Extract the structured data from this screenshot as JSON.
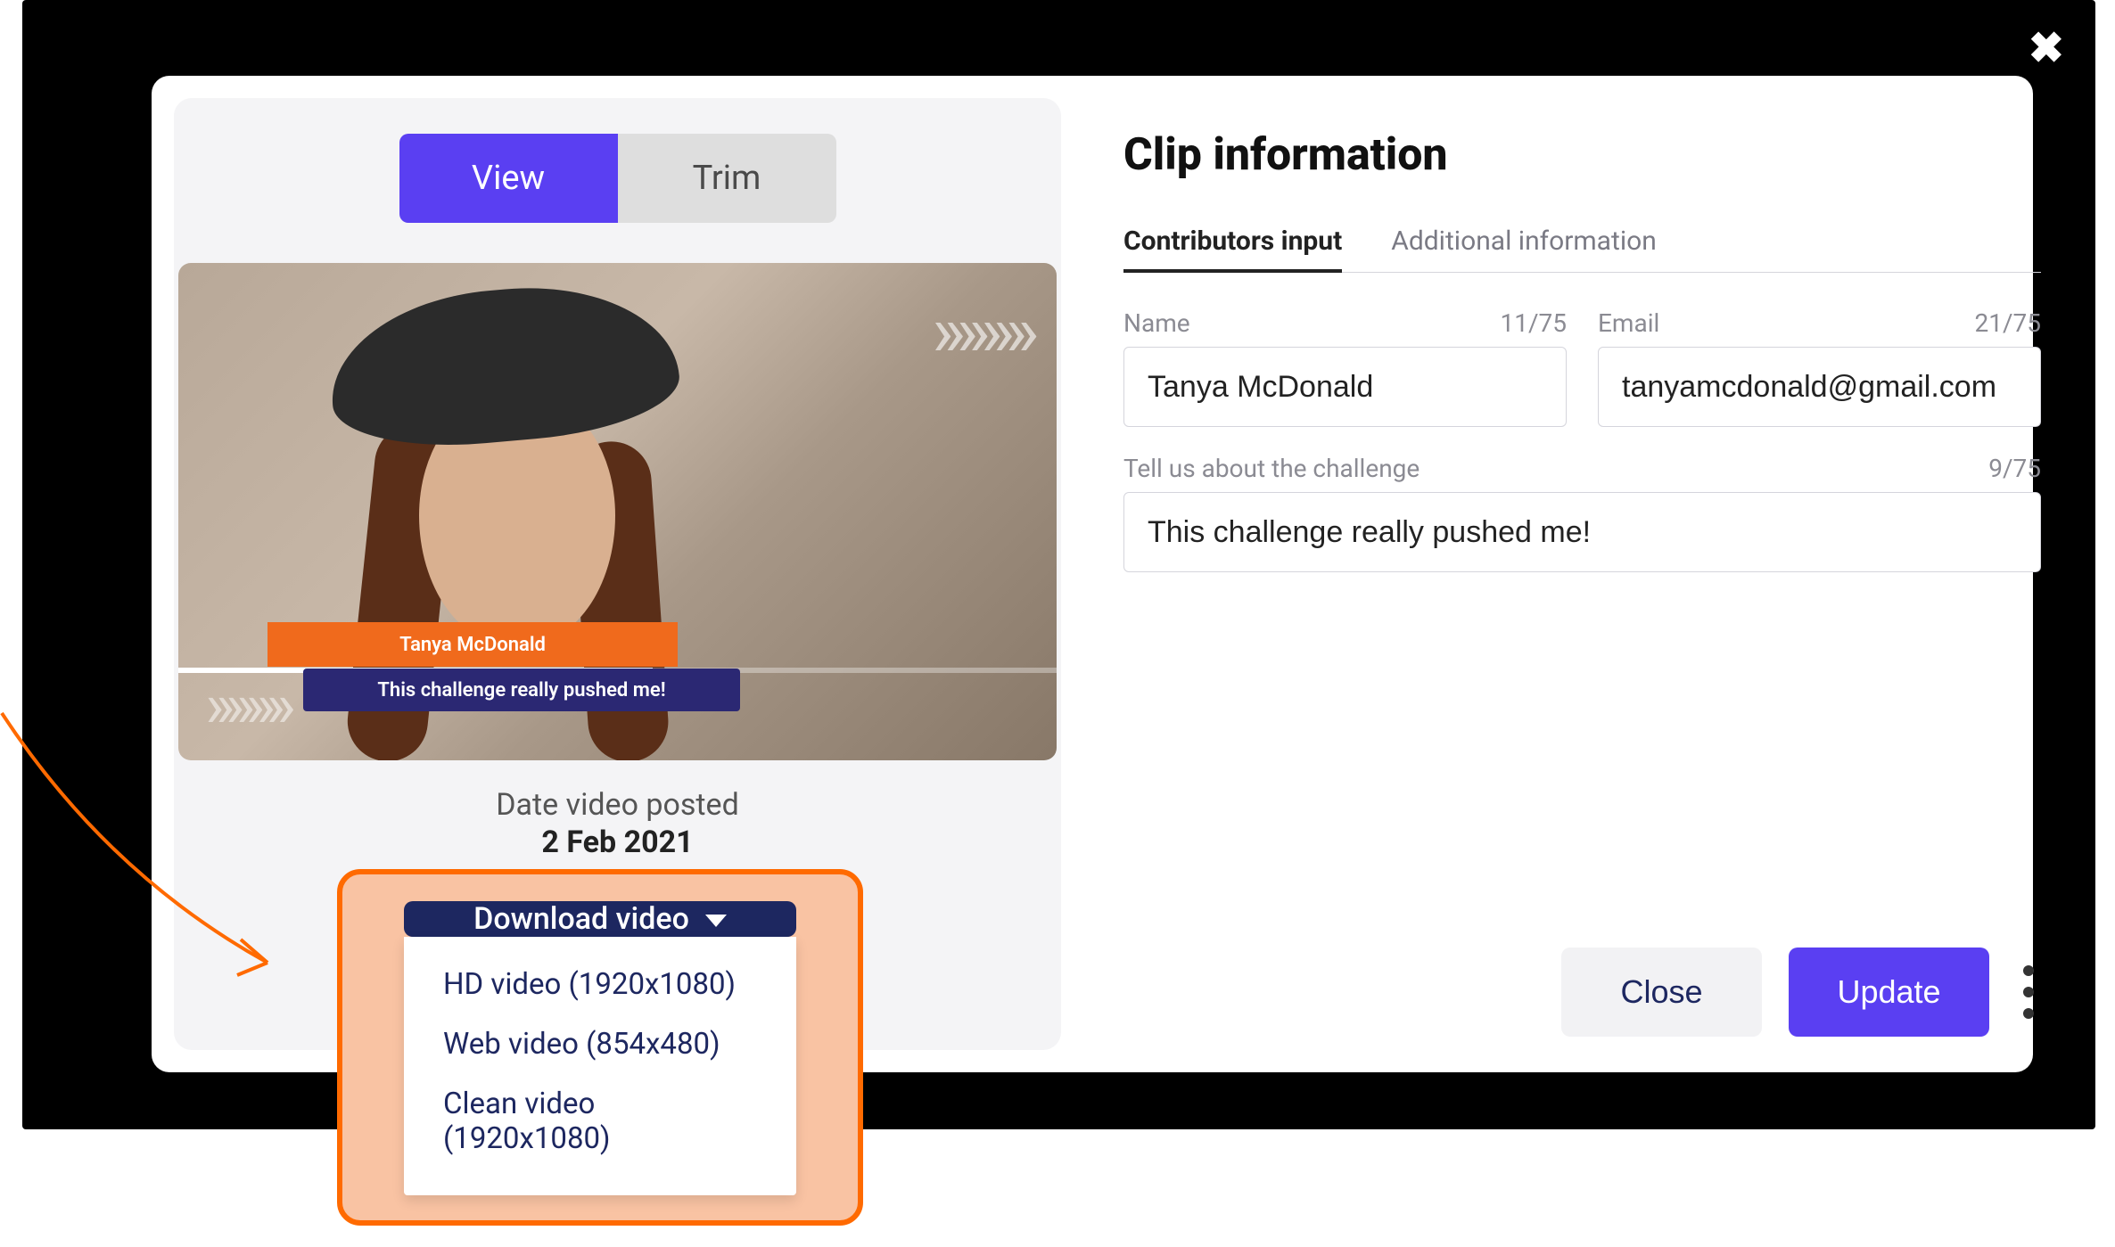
{
  "modal": {
    "close_icon": "✖"
  },
  "media_tabs": {
    "view": "View",
    "trim": "Trim"
  },
  "thumbnail": {
    "name_overlay": "Tanya McDonald",
    "quote_overlay": "This challenge really pushed me!",
    "chevrons": "»»»»"
  },
  "date": {
    "label": "Date video posted",
    "value": "2 Feb 2021"
  },
  "download": {
    "button": "Download video",
    "options": [
      "HD video (1920x1080)",
      "Web video (854x480)",
      "Clean video (1920x1080)"
    ]
  },
  "info": {
    "title": "Clip information",
    "tabs": {
      "contributors": "Contributors input",
      "additional": "Additional information"
    },
    "fields": {
      "name": {
        "label": "Name",
        "count": "11/75",
        "value": "Tanya McDonald"
      },
      "email": {
        "label": "Email",
        "count": "21/75",
        "value": "tanyamcdonald@gmail.com"
      },
      "challenge": {
        "label": "Tell us about the challenge",
        "count": "9/75",
        "value": "This challenge really pushed me!"
      }
    }
  },
  "actions": {
    "close": "Close",
    "update": "Update"
  }
}
